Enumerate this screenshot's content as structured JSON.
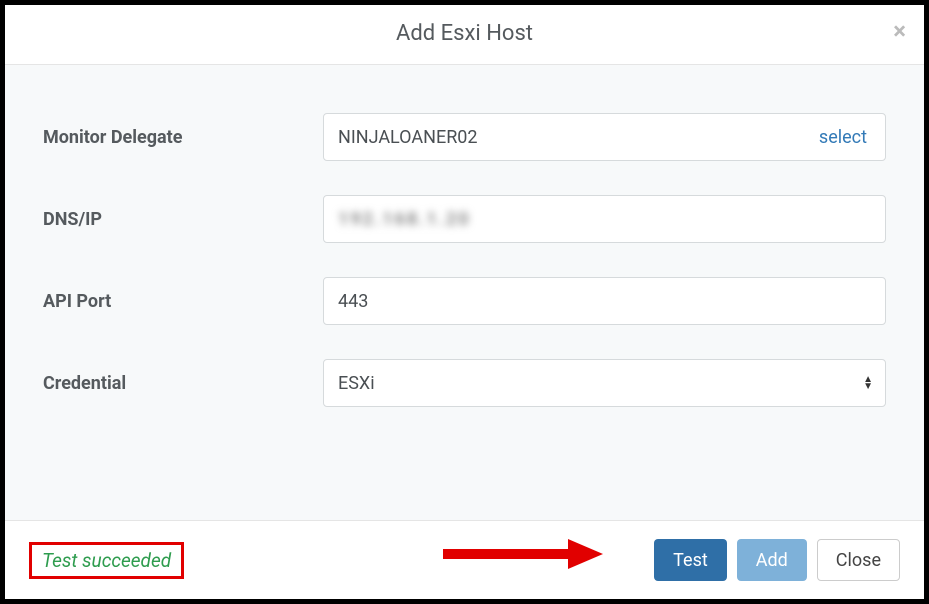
{
  "modal": {
    "title": "Add Esxi Host",
    "close_symbol": "×"
  },
  "fields": {
    "monitor_delegate": {
      "label": "Monitor Delegate",
      "value": "NINJALOANER02",
      "select_action": "select"
    },
    "dns_ip": {
      "label": "DNS/IP",
      "value": "192.168.1.20"
    },
    "api_port": {
      "label": "API Port",
      "value": "443"
    },
    "credential": {
      "label": "Credential",
      "value": "ESXi"
    }
  },
  "footer": {
    "status": "Test succeeded",
    "test_label": "Test",
    "add_label": "Add",
    "close_label": "Close"
  }
}
